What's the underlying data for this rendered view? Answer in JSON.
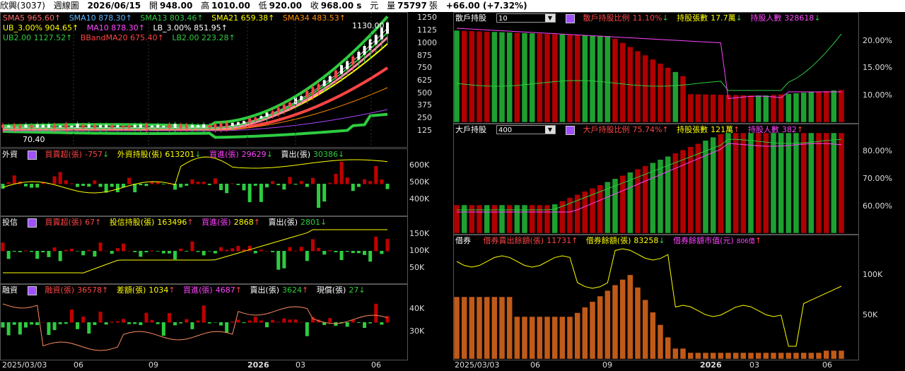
{
  "topbar": {
    "stock": "欣興(3037)",
    "period": "週線圖",
    "date": "2026/06/15",
    "open_label": "開",
    "open": "948.00",
    "high_label": "高",
    "high": "1010.00",
    "low_label": "低",
    "low": "920.00",
    "close_label": "收",
    "close": "968.00 s",
    "currency": "元",
    "vol_label": "量",
    "volume": "75797",
    "vol_unit": "張",
    "change": "+66.00 (+7.32%)"
  },
  "price": {
    "indicators": [
      {
        "text": "SMA5 965.60↑",
        "color": "#ff6a6a"
      },
      {
        "text": "SMA10 878.30↑",
        "color": "#5ab4ff"
      },
      {
        "text": "SMA13 803.46↑",
        "color": "#2ecc40"
      },
      {
        "text": "SMA21 659.38↑",
        "color": "#ffff00"
      },
      {
        "text": "SMA34 483.53↑",
        "color": "#ff8c00"
      },
      {
        "text": "UB_3.00% 904.65↑",
        "color": "#ffff00"
      },
      {
        "text": "MA10 878.30↑",
        "color": "#ff4aff"
      },
      {
        "text": "LB_3.00% 851.95↑",
        "color": "#ffffff"
      },
      {
        "text": "UB2.00 1127.52↑",
        "color": "#2ecc40"
      },
      {
        "text": "BBandMA20 675.40↑",
        "color": "#ff4444"
      },
      {
        "text": "LB2.00 223.28↑",
        "color": "#2ecc40"
      }
    ],
    "high_mark": "1130.00",
    "low_mark": "70.40",
    "yticks": [
      "1250",
      "1125",
      "1000",
      "875",
      "750",
      "625",
      "500",
      "375",
      "250",
      "125"
    ]
  },
  "foreign": {
    "title": "外資",
    "items": [
      {
        "label": "買賣超(張)",
        "value": "-757",
        "arrow": "↓",
        "vcolor": "#ff4444"
      },
      {
        "label": "外資持股(張)",
        "value": "613201",
        "arrow": "↓",
        "vcolor": "#ffff00"
      },
      {
        "label": "買進(張)",
        "value": "29629",
        "arrow": "↓",
        "vcolor": "#ff44ff"
      },
      {
        "label": "賣出(張)",
        "value": "30386",
        "arrow": "↓",
        "vcolor": "#2ecc40"
      }
    ],
    "yticks": [
      "600K",
      "500K",
      "400K"
    ]
  },
  "trust": {
    "title": "投信",
    "items": [
      {
        "label": "買賣超(張)",
        "value": "67",
        "arrow": "↑",
        "vcolor": "#ff4444"
      },
      {
        "label": "投信持股(張)",
        "value": "163496",
        "arrow": "↑",
        "vcolor": "#ffff00"
      },
      {
        "label": "買進(張)",
        "value": "2868",
        "arrow": "↑",
        "vcolor": "#ff44ff"
      },
      {
        "label": "賣出(張)",
        "value": "2801",
        "arrow": "↓",
        "vcolor": "#2ecc40"
      }
    ],
    "yticks": [
      "150K",
      "100K",
      "50K"
    ]
  },
  "margin": {
    "title": "融資",
    "items": [
      {
        "label": "融資(張)",
        "value": "36578",
        "arrow": "↑",
        "vcolor": "#ff4444"
      },
      {
        "label": "差額(張)",
        "value": "1034",
        "arrow": "↑",
        "vcolor": "#ffff00"
      },
      {
        "label": "買進(張)",
        "value": "4687",
        "arrow": "↑",
        "vcolor": "#ff44ff"
      },
      {
        "label": "賣出(張)",
        "value": "3624",
        "arrow": "↑",
        "vcolor": "#2ecc40"
      },
      {
        "label": "現償(張)",
        "value": "27",
        "arrow": "↓",
        "vcolor": "#2ecc40"
      }
    ],
    "yticks": [
      "40K",
      "30K"
    ]
  },
  "xaxis_left": [
    "2025/03/03",
    "06",
    "09",
    "2026",
    "03",
    "06"
  ],
  "retail": {
    "title": "散戶持股",
    "combo": "10",
    "items": [
      {
        "label": "散戶持股比例",
        "value": "11.10%",
        "arrow": "↓",
        "lcolor": "#ff4444",
        "vcolor": "#ff4444"
      },
      {
        "label": "持股張數",
        "value": "17.7萬",
        "arrow": "↓",
        "lcolor": "#ffff00",
        "vcolor": "#ffff00"
      },
      {
        "label": "持股人數",
        "value": "328618",
        "arrow": "↓",
        "lcolor": "#ff44ff",
        "vcolor": "#ff44ff"
      }
    ],
    "yticks": [
      "20.00%",
      "15.00%",
      "10.00%"
    ]
  },
  "major": {
    "title": "大戶持股",
    "combo": "400",
    "items": [
      {
        "label": "大戶持股比例",
        "value": "75.74%",
        "arrow": "↑",
        "lcolor": "#ff4444",
        "vcolor": "#ff4444"
      },
      {
        "label": "持股張數",
        "value": "121萬",
        "arrow": "↑",
        "lcolor": "#ffff00",
        "vcolor": "#ffff00"
      },
      {
        "label": "持股人數",
        "value": "382",
        "arrow": "↑",
        "lcolor": "#ff44ff",
        "vcolor": "#ff44ff"
      }
    ],
    "yticks": [
      "80.00%",
      "70.00%",
      "60.00%"
    ]
  },
  "lending": {
    "title": "借券",
    "items": [
      {
        "label": "借券賣出餘額(張)",
        "value": "11731",
        "arrow": "↑",
        "lcolor": "#ff4444",
        "vcolor": "#ff4444"
      },
      {
        "label": "借券餘額(張)",
        "value": "83258",
        "arrow": "↓",
        "lcolor": "#ffff00",
        "vcolor": "#ffff00"
      },
      {
        "label": "借券餘額市值(元)",
        "value": "806億",
        "arrow": "↑",
        "lcolor": "#ff44ff",
        "vcolor": "#ff44ff"
      }
    ],
    "yticks": [
      "100K",
      "50K"
    ]
  },
  "xaxis_right": [
    "2025/03/03",
    "06",
    "09",
    "2026",
    "03",
    "06"
  ]
}
